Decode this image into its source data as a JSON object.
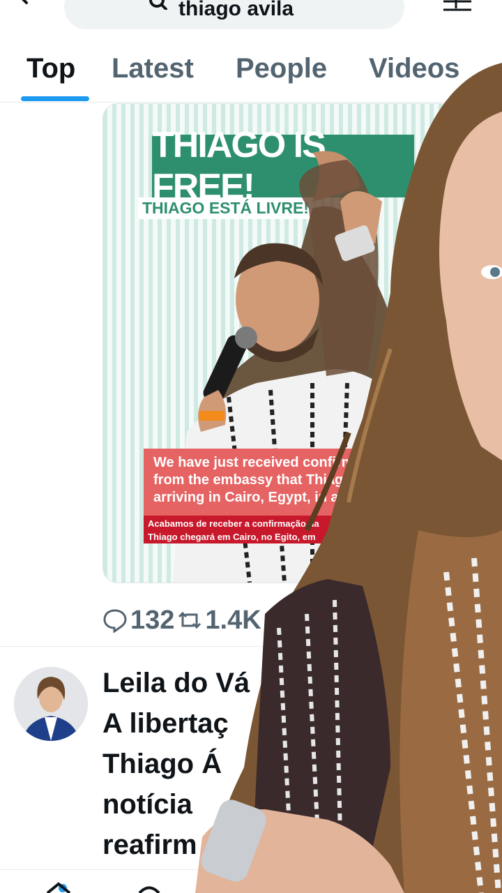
{
  "search": {
    "query": "thiago avila"
  },
  "tabs": [
    {
      "label": "Top",
      "active": true
    },
    {
      "label": "Latest",
      "active": false
    },
    {
      "label": "People",
      "active": false
    },
    {
      "label": "Videos",
      "active": false
    }
  ],
  "post_image": {
    "banner": "THIAGO  IS FREE!",
    "subtitle": "THIAGO ESTÁ LIVRE!",
    "red_lines": [
      "We have just received confirmat",
      "from the embassy that Thiago w",
      "arriving in Cairo, Egypt, in a few"
    ],
    "red_sub_lines": [
      "Acabamos de receber a confirmação da",
      "Thiago chegará em Cairo, no Egito, em"
    ]
  },
  "post_actions": {
    "replies": "132",
    "reposts": "1.4K"
  },
  "next_tweet": {
    "lines": [
      "Leila do Vá",
      "A libertaç",
      "Thiago Á",
      "notícia",
      "reafirm"
    ]
  },
  "colors": {
    "accent": "#1d9bf0",
    "green": "#2e8f6f",
    "red": "#e66363"
  },
  "icons": [
    "back-arrow-icon",
    "search-icon",
    "filter-icon",
    "reply-icon",
    "repost-icon"
  ]
}
